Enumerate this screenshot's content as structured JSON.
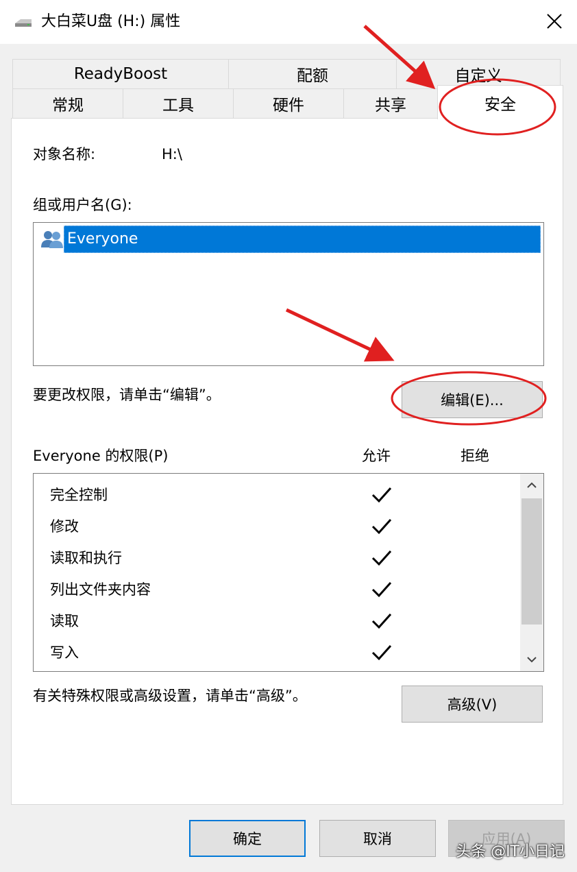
{
  "window": {
    "title": "大白菜U盘 (H:) 属性",
    "icon": "drive-icon",
    "close_icon": "close-icon"
  },
  "tabs": {
    "row1": [
      "ReadyBoost",
      "配额",
      "自定义"
    ],
    "row2": [
      "常规",
      "工具",
      "硬件",
      "共享",
      "安全"
    ],
    "active": "安全"
  },
  "security": {
    "object_label": "对象名称:",
    "object_value": "H:\\",
    "group_label": "组或用户名(G):",
    "users": [
      {
        "name": "Everyone",
        "icon": "users-group-icon",
        "selected": true
      }
    ],
    "change_text": "要更改权限，请单击“编辑”。",
    "edit_button": "编辑(E)...",
    "perm_title": "Everyone 的权限(P)",
    "allow_header": "允许",
    "deny_header": "拒绝",
    "permissions": [
      {
        "name": "完全控制",
        "allow": true,
        "deny": false
      },
      {
        "name": "修改",
        "allow": true,
        "deny": false
      },
      {
        "name": "读取和执行",
        "allow": true,
        "deny": false
      },
      {
        "name": "列出文件夹内容",
        "allow": true,
        "deny": false
      },
      {
        "name": "读取",
        "allow": true,
        "deny": false
      },
      {
        "name": "写入",
        "allow": true,
        "deny": false
      }
    ],
    "advanced_text": "有关特殊权限或高级设置，请单击“高级”。",
    "advanced_button": "高级(V)"
  },
  "buttons": {
    "ok": "确定",
    "cancel": "取消",
    "apply": "应用(A)"
  },
  "annotation_color": "#e02020",
  "watermark": "头条 @IT小日记"
}
